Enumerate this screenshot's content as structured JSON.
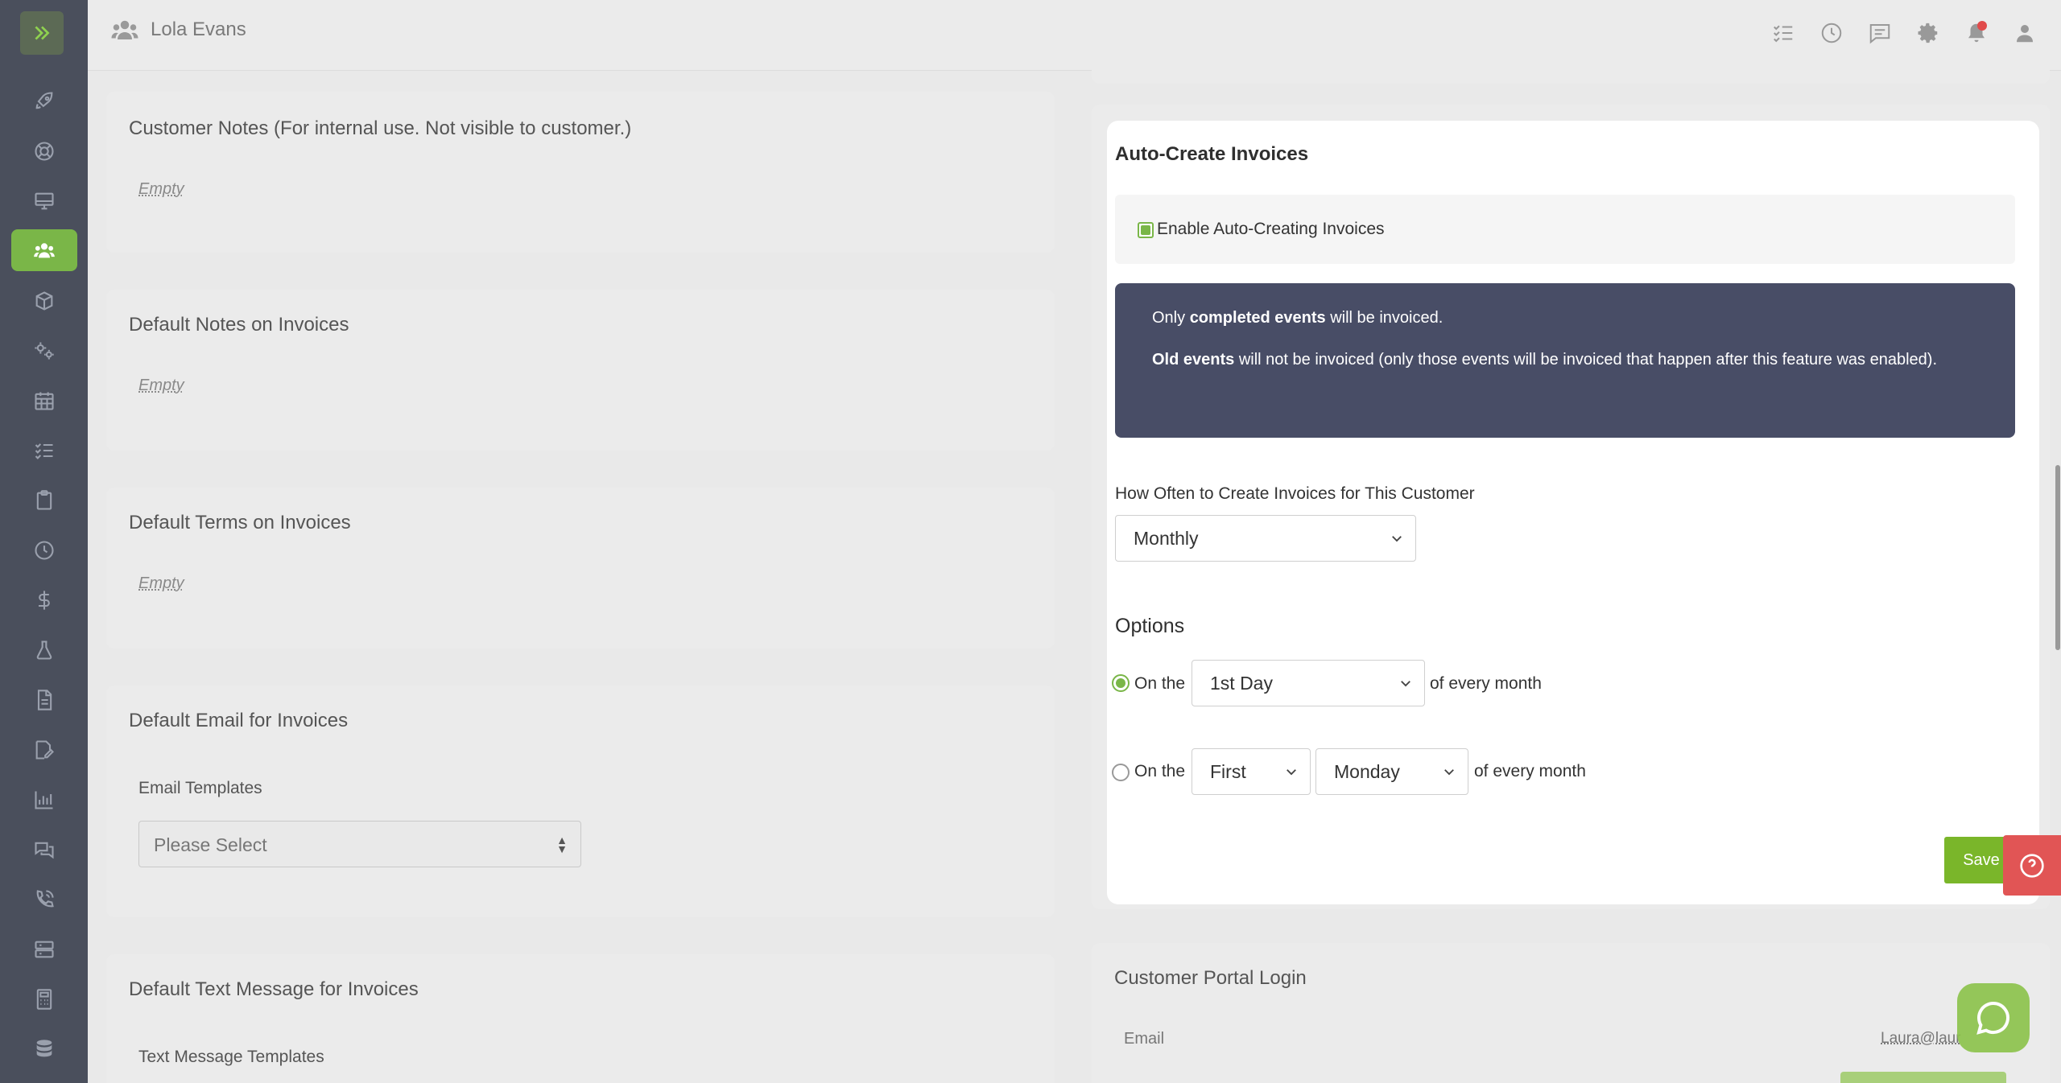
{
  "header": {
    "customer_name": "Lola Evans"
  },
  "left": {
    "customer_notes": {
      "title": "Customer Notes (For internal use. Not visible to customer.)",
      "value": "Empty"
    },
    "default_notes": {
      "title": "Default Notes on Invoices",
      "value": "Empty"
    },
    "default_terms": {
      "title": "Default Terms on Invoices",
      "value": "Empty"
    },
    "default_email": {
      "title": "Default Email for Invoices",
      "label": "Email Templates",
      "selected": "Please Select"
    },
    "default_text": {
      "title": "Default Text Message for Invoices",
      "label": "Text Message Templates"
    }
  },
  "modal": {
    "title": "Auto-Create Invoices",
    "enable_label": "Enable Auto-Creating Invoices",
    "enabled": true,
    "info": {
      "line1_prefix": "Only ",
      "line1_bold": "completed events",
      "line1_suffix": " will be invoiced.",
      "line2_bold": "Old events",
      "line2_suffix": " will not be invoiced (only those events will be invoiced that happen after this feature was enabled)."
    },
    "frequency_label": "How Often to Create Invoices for This Customer",
    "frequency_value": "Monthly",
    "options_title": "Options",
    "option1": {
      "prefix": "On the",
      "day": "1st Day",
      "suffix": "of every month",
      "selected": true
    },
    "option2": {
      "prefix": "On the",
      "ordinal": "First",
      "weekday": "Monday",
      "suffix": "of every month",
      "selected": false
    },
    "save_label": "Save"
  },
  "portal": {
    "title": "Customer Portal Login",
    "email_label": "Email",
    "email_value": "Laura@laur"
  },
  "colors": {
    "accent": "#7ab648",
    "sidebar": "#4a4f5c",
    "info_bg": "#484d66",
    "help": "#e15555"
  },
  "icons": {
    "sidebar": [
      "rocket-icon",
      "lifebuoy-icon",
      "monitor-icon",
      "users-icon",
      "box-icon",
      "gears-icon",
      "calendar-icon",
      "checklist-icon",
      "clipboard-icon",
      "clock-icon",
      "dollar-icon",
      "flask-icon",
      "document-icon",
      "signature-icon",
      "chart-icon",
      "chat-icon",
      "phone-icon",
      "storage-icon",
      "calculator-icon",
      "database-icon"
    ]
  }
}
